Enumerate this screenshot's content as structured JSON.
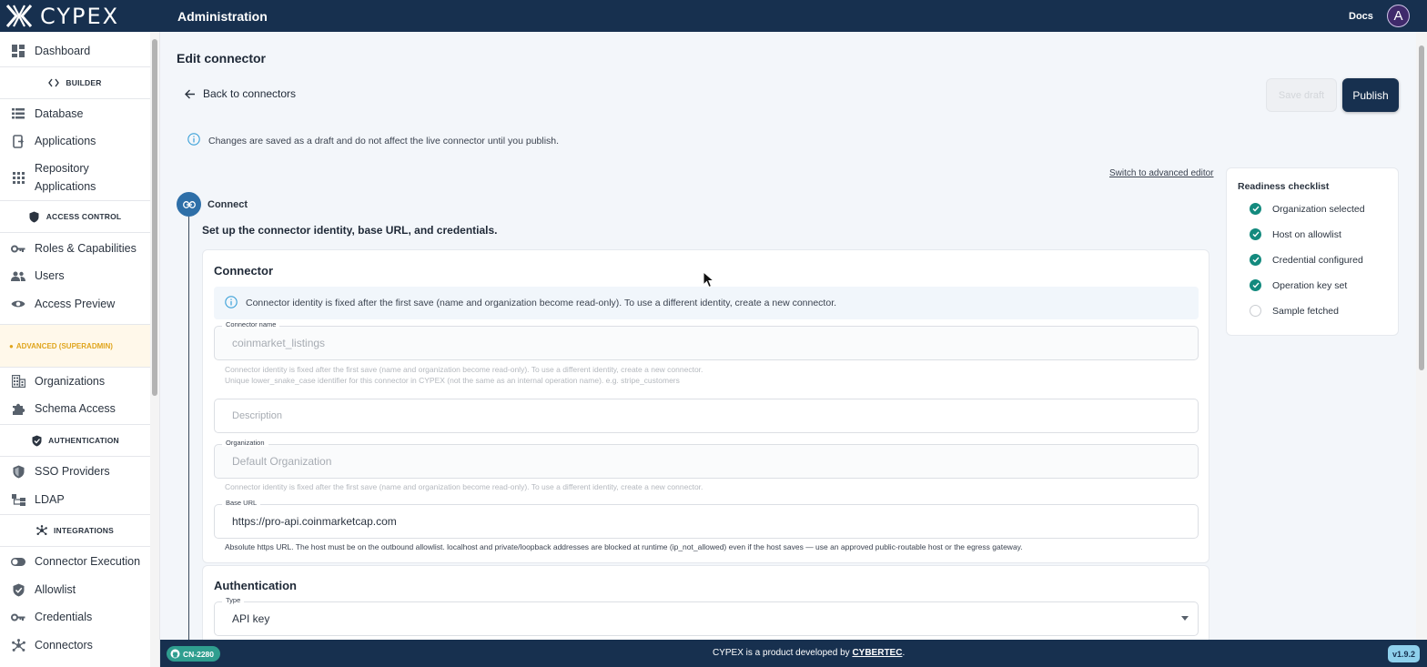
{
  "header": {
    "logo_text": "CYPEX",
    "title": "Administration",
    "docs_label": "Docs",
    "avatar_initial": "A"
  },
  "sidebar": {
    "dashboard": {
      "label": "Dashboard",
      "icon": "dashboard-icon"
    },
    "builder_header": "BUILDER",
    "builder_items": [
      {
        "label": "Database",
        "icon": "database-icon"
      },
      {
        "label": "Applications",
        "icon": "applications-icon"
      },
      {
        "label": "Repository Applications",
        "icon": "grid-icon"
      }
    ],
    "access_header": "ACCESS CONTROL",
    "access_items": [
      {
        "label": "Roles & Capabilities",
        "icon": "key-icon"
      },
      {
        "label": "Users",
        "icon": "users-icon"
      },
      {
        "label": "Access Preview",
        "icon": "eye-icon"
      }
    ],
    "advanced_header": "ADVANCED (SUPERADMIN)",
    "advanced_items": [
      {
        "label": "Organizations",
        "icon": "organization-icon"
      },
      {
        "label": "Schema Access",
        "icon": "puzzle-icon"
      }
    ],
    "auth_header": "AUTHENTICATION",
    "auth_items": [
      {
        "label": "SSO Providers",
        "icon": "shield-icon"
      },
      {
        "label": "LDAP",
        "icon": "ldap-icon"
      }
    ],
    "integrations_header": "INTEGRATIONS",
    "integrations_items": [
      {
        "label": "Connector Execution",
        "icon": "toggle-icon"
      },
      {
        "label": "Allowlist",
        "icon": "shield-check-icon"
      },
      {
        "label": "Credentials",
        "icon": "key-icon"
      },
      {
        "label": "Connectors",
        "icon": "hub-icon"
      }
    ]
  },
  "page": {
    "title": "Edit connector",
    "back_label": "Back to connectors",
    "save_draft_label": "Save draft",
    "publish_label": "Publish",
    "draft_info": "Changes are saved as a draft and do not affect the live connector until you publish.",
    "switch_label": "Switch to advanced editor",
    "step": {
      "label": "Connect",
      "description": "Set up the connector identity, base URL, and credentials."
    }
  },
  "connector_card": {
    "title": "Connector",
    "identity_info": "Connector identity is fixed after the first save (name and organization become read-only). To use a different identity, create a new connector.",
    "name_label": "Connector name",
    "name_value": "coinmarket_listings",
    "name_help_1": "Connector identity is fixed after the first save (name and organization become read-only). To use a different identity, create a new connector.",
    "name_help_2": "Unique lower_snake_case identifier for this connector in CYPEX (not the same as an internal operation name). e.g. stripe_customers",
    "description_placeholder": "Description",
    "organization_label": "Organization",
    "organization_value": "Default Organization",
    "organization_help": "Connector identity is fixed after the first save (name and organization become read-only). To use a different identity, create a new connector.",
    "base_url_label": "Base URL",
    "base_url_value": "https://pro-api.coinmarketcap.com",
    "base_url_help": "Absolute https URL. The host must be on the outbound allowlist. localhost and private/loopback addresses are blocked at runtime (ip_not_allowed) even if the host saves — use an approved public-routable host or the egress gateway."
  },
  "auth_card": {
    "title": "Authentication",
    "type_label": "Type",
    "type_value": "API key"
  },
  "checklist": {
    "title": "Readiness checklist",
    "items": [
      {
        "label": "Organization selected",
        "done": true
      },
      {
        "label": "Host on allowlist",
        "done": true
      },
      {
        "label": "Credential configured",
        "done": true
      },
      {
        "label": "Operation key set",
        "done": true
      },
      {
        "label": "Sample fetched",
        "done": false
      }
    ]
  },
  "footer": {
    "badge": "CN-2280",
    "text_prefix": "CYPEX is a product developed by ",
    "company": "CYBERTEC",
    "text_suffix": ".",
    "version": "v1.9.2"
  },
  "colors": {
    "topbar": "#17304f",
    "accent_done": "#138a7e",
    "advanced": "#e0a51d",
    "version_badge": "#8fd0ec"
  }
}
